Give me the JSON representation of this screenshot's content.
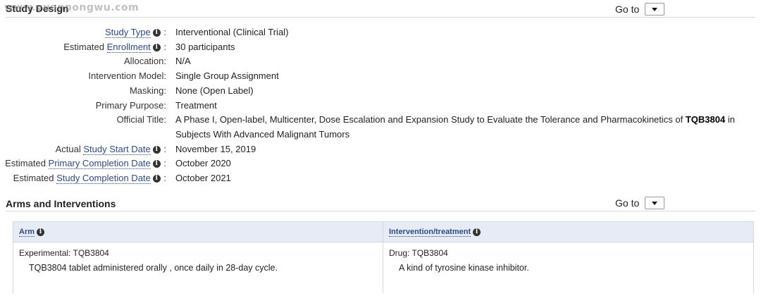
{
  "watermark": "www.yuanpongwu.com",
  "study_design": {
    "title": "Study Design",
    "goto_label": "Go to",
    "rows": [
      {
        "label": "Study Type",
        "has_info": true,
        "value": "Interventional  (Clinical Trial)"
      },
      {
        "label_prefix": "Estimated ",
        "label": "Enrollment",
        "has_info": true,
        "value": "30 participants"
      },
      {
        "label": "Allocation:",
        "value": "N/A"
      },
      {
        "label": "Intervention Model:",
        "value": "Single Group Assignment"
      },
      {
        "label": "Masking:",
        "value": "None (Open Label)"
      },
      {
        "label": "Primary Purpose:",
        "value": "Treatment"
      },
      {
        "label": "Official Title:",
        "value_prefix": "A Phase I, Open-label, Multicenter, Dose Escalation and Expansion Study to Evaluate the Tolerance and Pharmacokinetics of ",
        "value_bold": "TQB3804",
        "value_suffix": " in Subjects With Advanced Malignant Tumors"
      },
      {
        "label_prefix": "Actual ",
        "label": "Study Start Date",
        "has_info": true,
        "value": "November 15, 2019"
      },
      {
        "label_prefix": "Estimated ",
        "label": "Primary Completion Date",
        "has_info": true,
        "value": "October 2020"
      },
      {
        "label_prefix": "Estimated ",
        "label": "Study Completion Date",
        "has_info": true,
        "value": "October 2021"
      }
    ]
  },
  "arms": {
    "title": "Arms and Interventions",
    "goto_label": "Go to",
    "col_arm": "Arm",
    "col_intervention": "Intervention/treatment",
    "arm_title": "Experimental: TQB3804",
    "arm_desc": "TQB3804 tablet administered orally , once daily in 28-day cycle.",
    "int_title": "Drug: TQB3804",
    "int_desc": "A kind of tyrosine kinase inhibitor."
  }
}
